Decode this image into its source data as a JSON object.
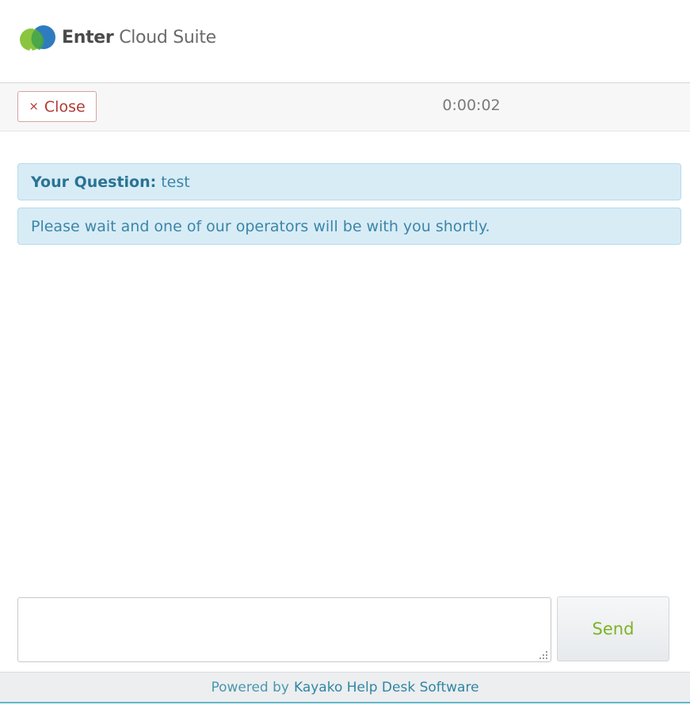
{
  "header": {
    "logo": {
      "bold": "Enter",
      "light": "Cloud Suite",
      "colors": {
        "blue": "#2f7bbf",
        "green": "#8bc53f"
      }
    }
  },
  "toolbar": {
    "close_label": "Close",
    "close_icon": "×",
    "timer": "0:00:02"
  },
  "messages": {
    "question_label": "Your Question:",
    "question_text": "test",
    "wait_text": "Please wait and one of our operators will be with you shortly."
  },
  "composer": {
    "placeholder": "",
    "value": "",
    "send_label": "Send"
  },
  "footer": {
    "prefix": "Powered by",
    "link": "Kayako Help Desk Software"
  },
  "colors": {
    "info_bg": "#d8ecf6",
    "info_text": "#2e7ea0",
    "close": "#b23b35",
    "send": "#7eb324",
    "footer_accent": "#5fb7c7"
  }
}
